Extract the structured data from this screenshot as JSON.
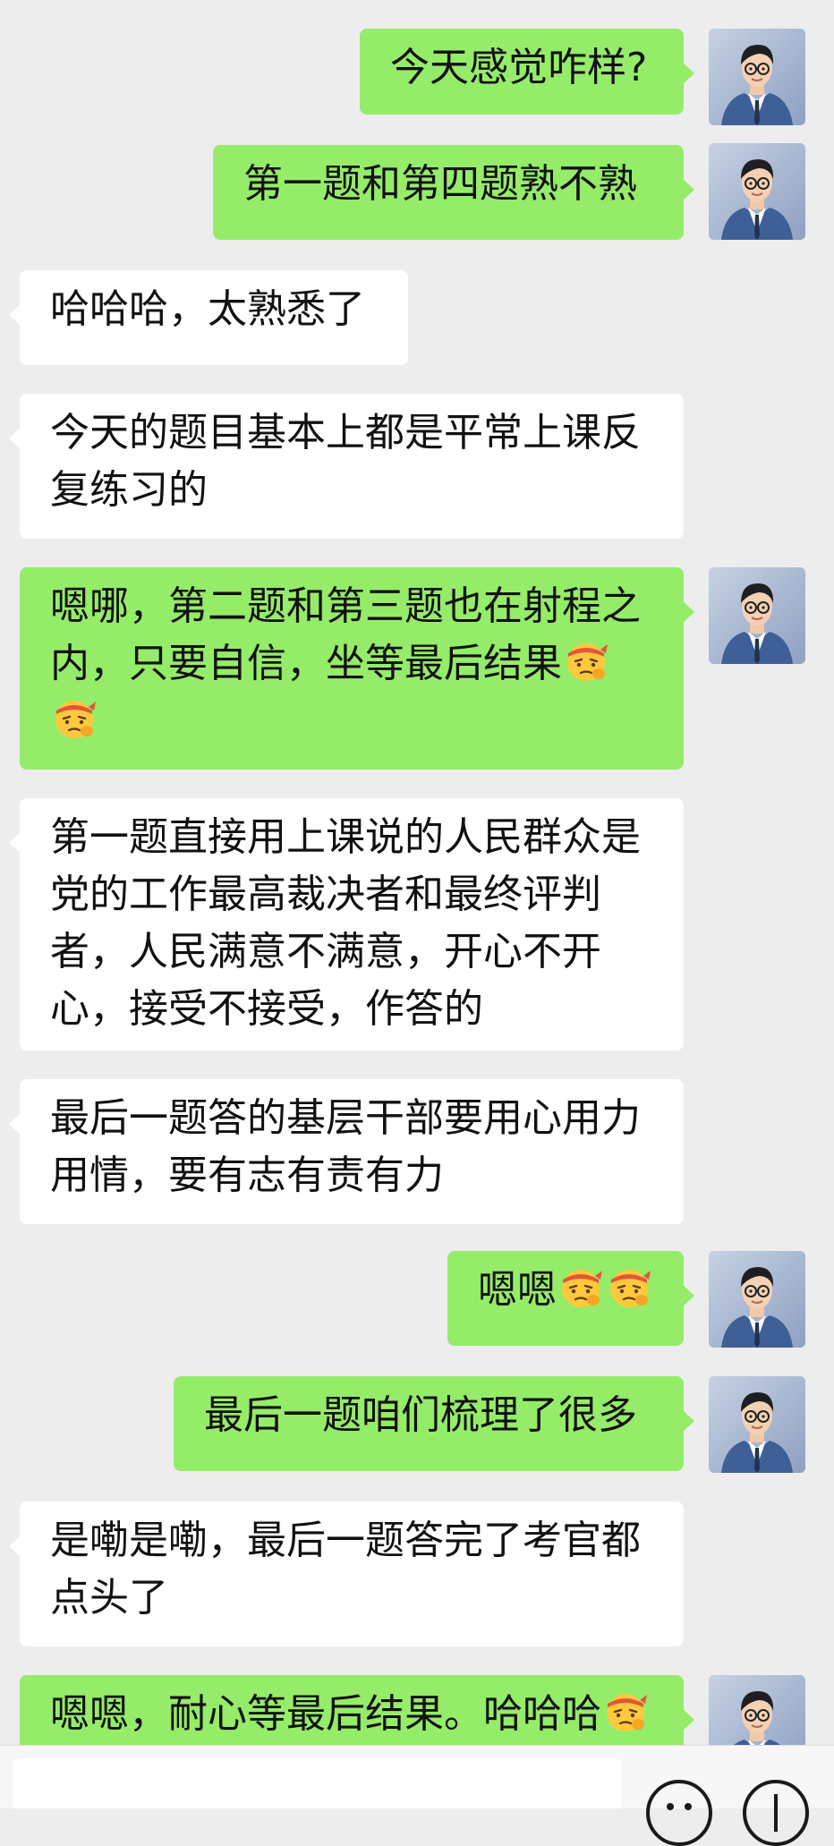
{
  "messages": [
    {
      "side": "out",
      "text": "今天感觉咋样?"
    },
    {
      "side": "out",
      "text": "第一题和第四题熟不熟"
    },
    {
      "side": "in",
      "text": "哈哈哈，太熟悉了"
    },
    {
      "side": "in",
      "text": "今天的题目基本上都是平常上课反复练习的"
    },
    {
      "side": "out",
      "text": "嗯哪，第二题和第三题也在射程之内，只要自信，坐等最后结果",
      "emoji_after": 2
    },
    {
      "side": "in",
      "text": "第一题直接用上课说的人民群众是党的工作最高裁决者和最终评判者，人民满意不满意，开心不开心，接受不接受，作答的"
    },
    {
      "side": "in",
      "text": "最后一题答的基层干部要用心用力用情，要有志有责有力"
    },
    {
      "side": "out",
      "text": "嗯嗯",
      "emoji_after": 2
    },
    {
      "side": "out",
      "text": "最后一题咱们梳理了很多"
    },
    {
      "side": "in",
      "text": "是嘞是嘞，最后一题答完了考官都点头了"
    },
    {
      "side": "out",
      "text": "嗯嗯，耐心等最后结果。哈哈哈",
      "emoji_after": 1
    }
  ],
  "emoji_name": "salute-emoji",
  "colors": {
    "background": "#ededed",
    "outgoing_bubble": "#95ec69",
    "incoming_bubble": "#ffffff"
  },
  "bottom_bar": {
    "icons": [
      "emoji-icon",
      "plus-icon"
    ]
  }
}
